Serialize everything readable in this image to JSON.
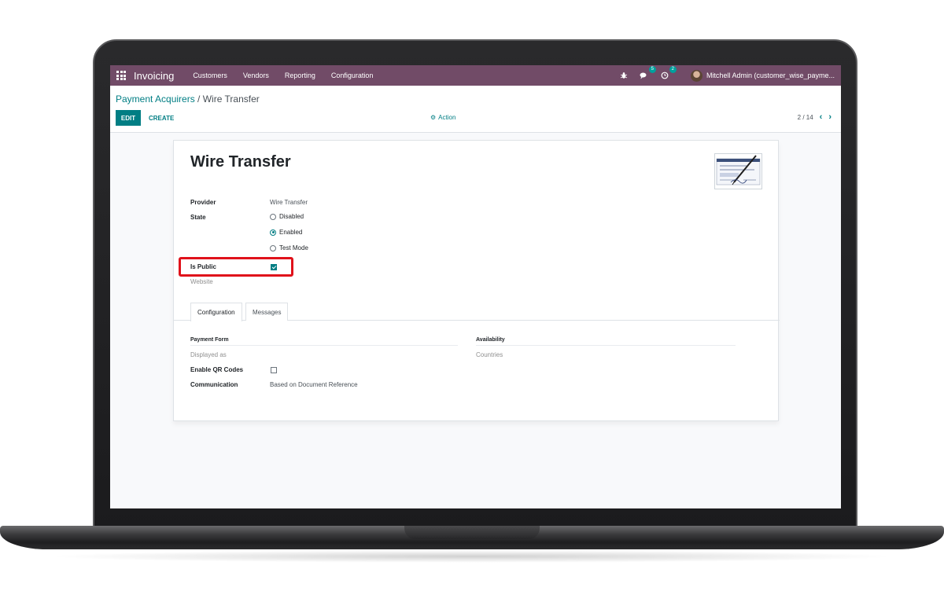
{
  "navbar": {
    "app_name": "Invoicing",
    "menu": [
      "Customers",
      "Vendors",
      "Reporting",
      "Configuration"
    ],
    "messages_badge": "5",
    "activities_badge": "2",
    "user_label": "Mitchell Admin (customer_wise_payme..."
  },
  "control_panel": {
    "breadcrumb_parent": "Payment Acquirers",
    "breadcrumb_separator": " / ",
    "breadcrumb_current": "Wire Transfer",
    "edit_label": "EDIT",
    "create_label": "CREATE",
    "action_label": "Action",
    "pager": "2 / 14"
  },
  "form": {
    "title": "Wire Transfer",
    "provider_label": "Provider",
    "provider_value": "Wire Transfer",
    "state_label": "State",
    "state_options": [
      "Disabled",
      "Enabled",
      "Test Mode"
    ],
    "state_selected": "Enabled",
    "is_public_label": "Is Public",
    "is_public_checked": true,
    "website_label": "Website"
  },
  "tabs": [
    "Configuration",
    "Messages"
  ],
  "configuration": {
    "payment_form_title": "Payment Form",
    "displayed_as_label": "Displayed as",
    "enable_qr_label": "Enable QR Codes",
    "enable_qr_checked": false,
    "communication_label": "Communication",
    "communication_value": "Based on Document Reference",
    "availability_title": "Availability",
    "countries_label": "Countries"
  },
  "colors": {
    "navbar": "#714b67",
    "primary": "#017e84",
    "highlight": "#e0121b"
  }
}
